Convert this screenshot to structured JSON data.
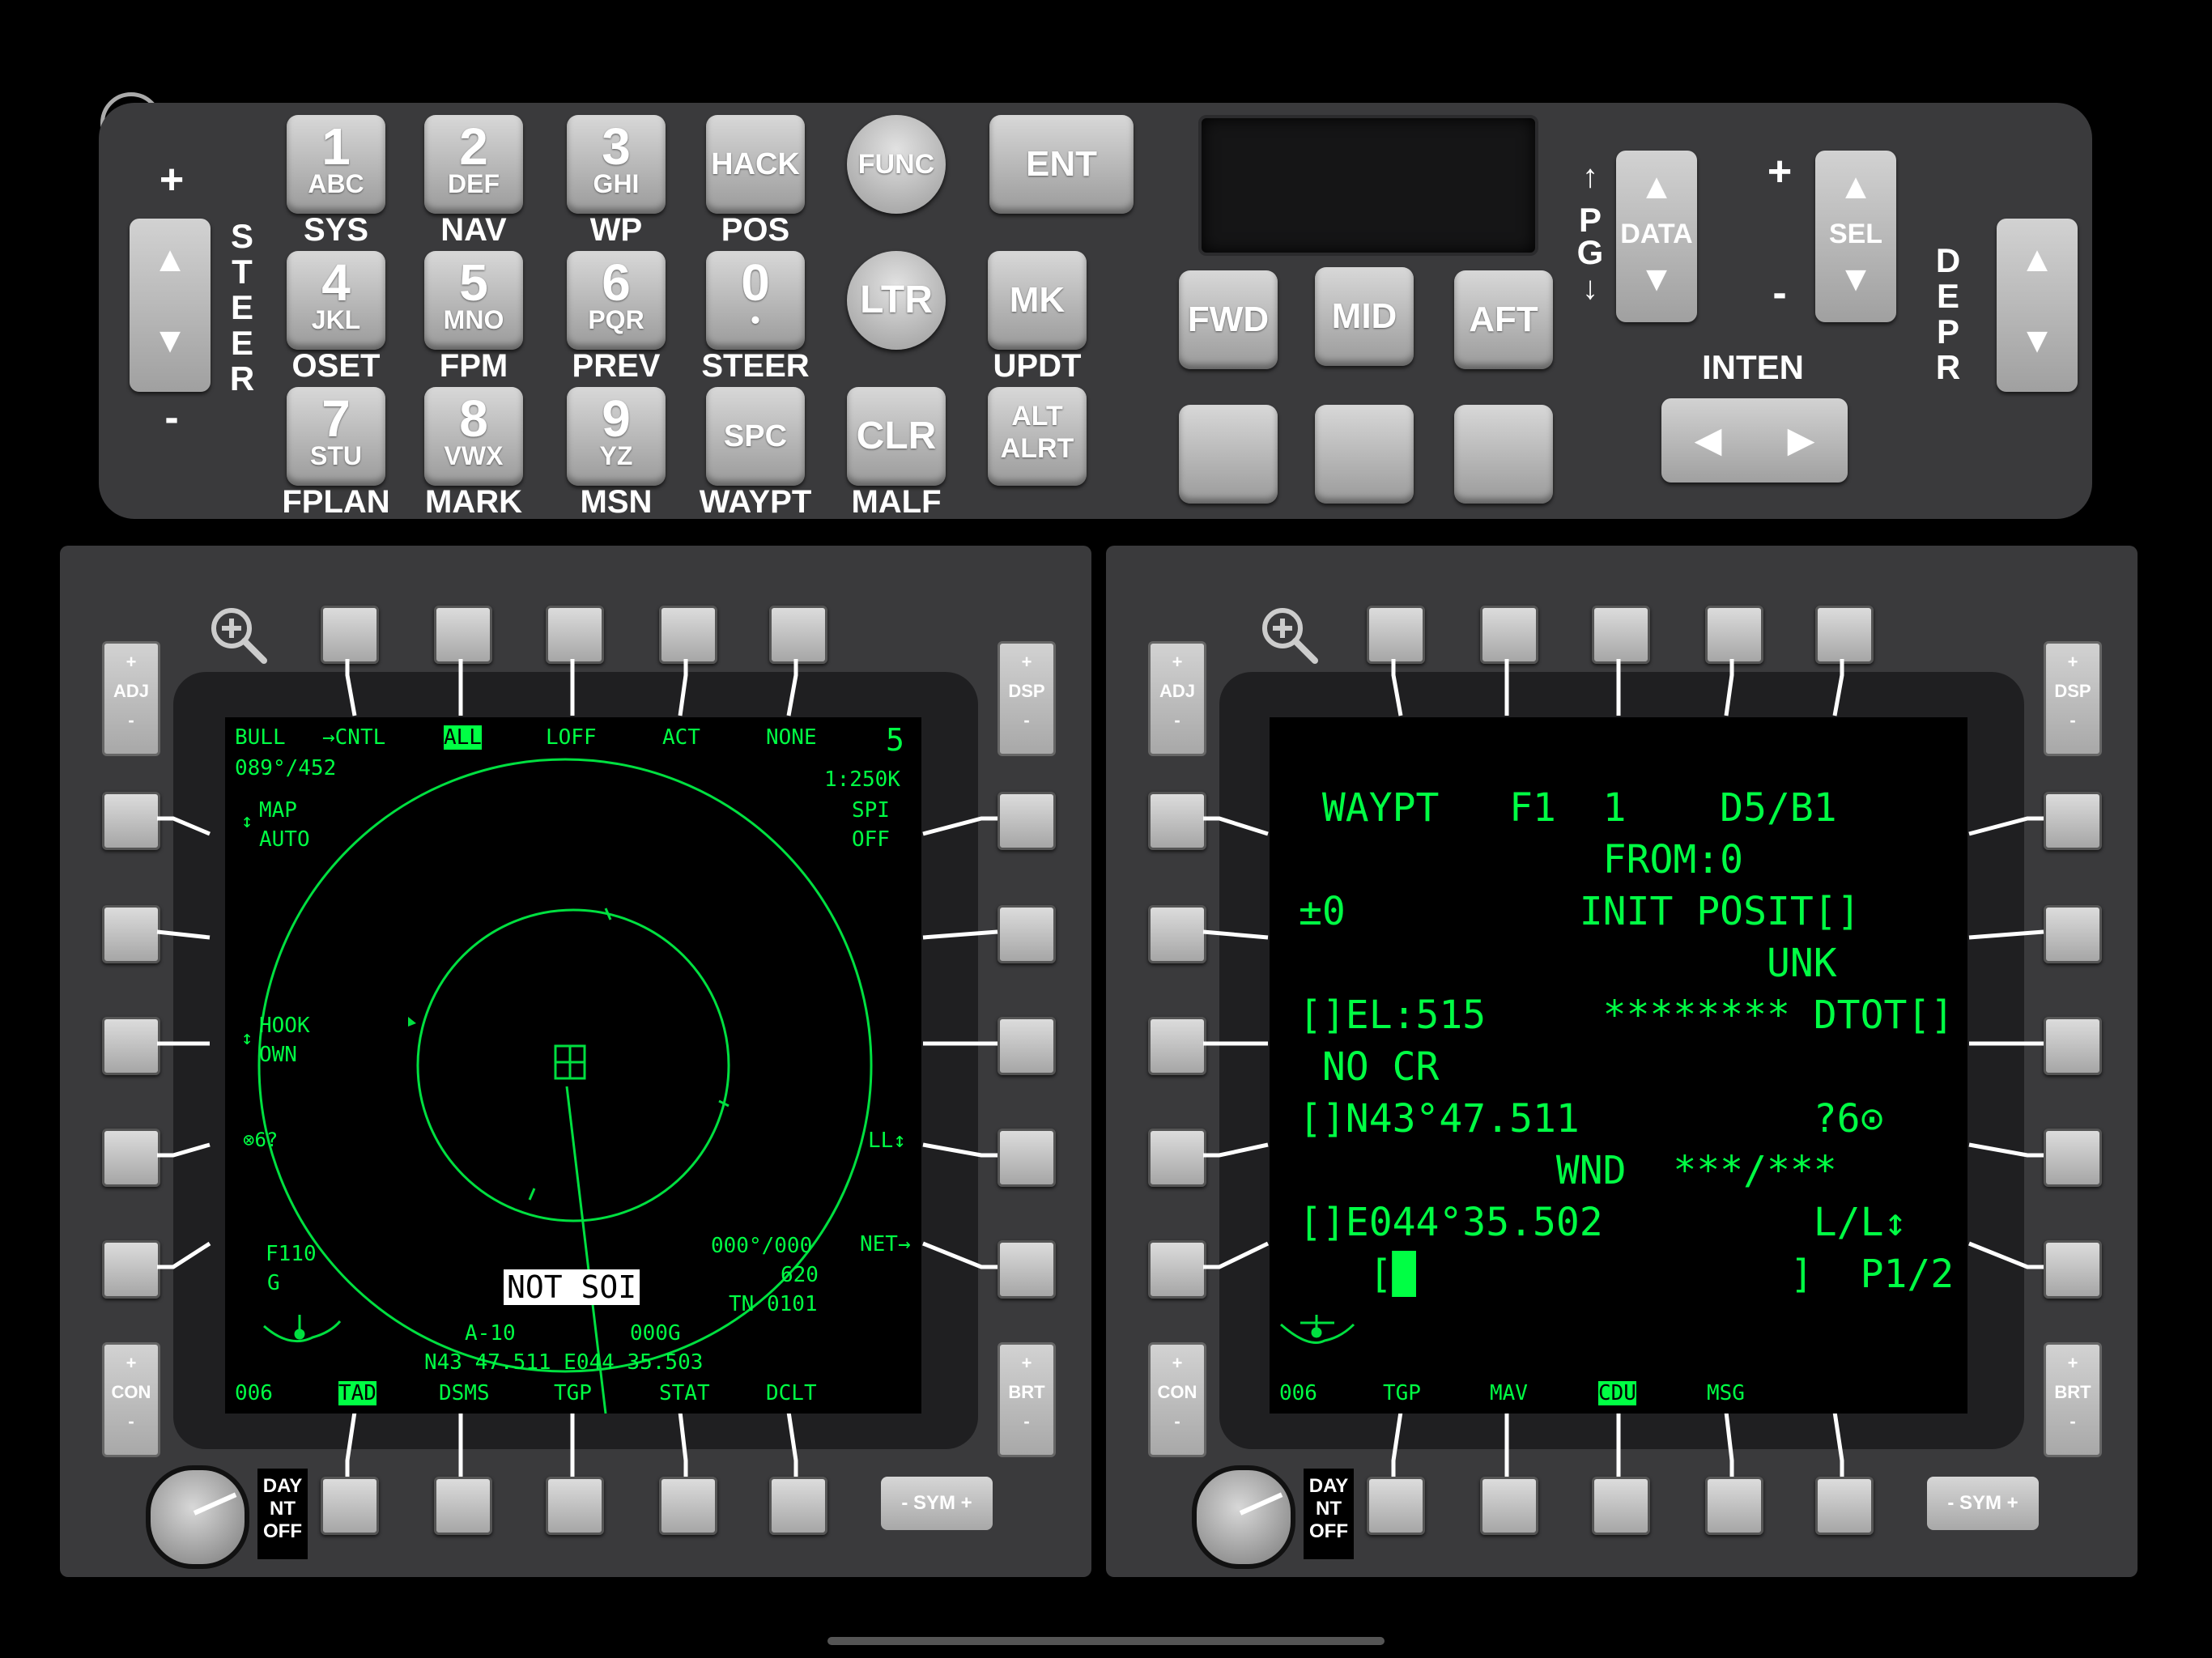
{
  "ufc": {
    "keys": [
      {
        "num": "1",
        "sub": "ABC",
        "label": "SYS"
      },
      {
        "num": "2",
        "sub": "DEF",
        "label": "NAV"
      },
      {
        "num": "3",
        "sub": "GHI",
        "label": "WP"
      },
      {
        "num": "4",
        "sub": "JKL",
        "label": "OSET"
      },
      {
        "num": "5",
        "sub": "MNO",
        "label": "FPM"
      },
      {
        "num": "6",
        "sub": "PQR",
        "label": "PREV"
      },
      {
        "num": "7",
        "sub": "STU",
        "label": "FPLAN"
      },
      {
        "num": "8",
        "sub": "VWX",
        "label": "MARK"
      },
      {
        "num": "9",
        "sub": "YZ",
        "label": "MSN"
      },
      {
        "num": "0",
        "sub": "•",
        "label": "STEER"
      }
    ],
    "hack": "HACK",
    "hack_label": "POS",
    "spc": "SPC",
    "spc_label": "WAYPT",
    "func": "FUNC",
    "ltr": "LTR",
    "clr": "CLR",
    "clr_label": "MALF",
    "ent": "ENT",
    "mk": "MK",
    "mk_label": "UPDT",
    "alt_alrt": [
      "ALT",
      "ALRT"
    ],
    "fwd": "FWD",
    "mid": "MID",
    "aft": "AFT",
    "steer_vertical": [
      "S",
      "T",
      "E",
      "E",
      "R"
    ],
    "pg_vertical": [
      "P",
      "G"
    ],
    "depr_vertical": [
      "D",
      "E",
      "P",
      "R"
    ],
    "plus": "+",
    "minus": "-",
    "data": "DATA",
    "sel": "SEL",
    "inten": "INTEN",
    "up": "▲",
    "down": "▼",
    "left": "◀",
    "right": "▶"
  },
  "left_mfd": {
    "side_adj": [
      "+",
      "ADJ",
      "-"
    ],
    "side_dsp": [
      "+",
      "DSP",
      "-"
    ],
    "side_con": [
      "+",
      "CON",
      "-"
    ],
    "side_brt": [
      "+",
      "BRT",
      "-"
    ],
    "day": [
      "DAY",
      "NT",
      "OFF"
    ],
    "sym": "-  SYM  +",
    "top": {
      "bull": "BULL",
      "cntl": "→CNTL",
      "all": "ALL",
      "loff": "LOFF",
      "act": "ACT",
      "none": "NONE",
      "page_num": "5"
    },
    "bull_val": "089°/452",
    "scale": "1:250K",
    "spi": "SPI",
    "spi_val": "OFF",
    "map": "MAP",
    "map_val": "AUTO",
    "hook": "HOOK",
    "hook_val": "OWN",
    "ll": "LL↕",
    "sixq": "⊗6?",
    "net": "NET→",
    "f110": "F110",
    "f110_g": "G",
    "bearing": "000°/000",
    "alt620": "620",
    "tn": "TN 0101",
    "not_soi": "NOT SOI",
    "a10": "A-10",
    "alt000": "000G",
    "pos": "N43 47.511 E044 35.503",
    "bottom": {
      "heading": "006",
      "tad": "TAD",
      "dsms": "DSMS",
      "tgp": "TGP",
      "stat": "STAT",
      "dclt": "DCLT"
    },
    "map_side_arrow": "↕",
    "hook_side_arrow": "↕"
  },
  "right_mfd": {
    "side_adj": [
      "+",
      "ADJ",
      "-"
    ],
    "side_dsp": [
      "+",
      "DSP",
      "-"
    ],
    "side_con": [
      "+",
      "CON",
      "-"
    ],
    "side_brt": [
      "+",
      "BRT",
      "-"
    ],
    "day": [
      "DAY",
      "NT",
      "OFF"
    ],
    "sym": "-  SYM  +",
    "lines": [
      " WAYPT   F1  1    D5/B1",
      "             FROM:0",
      "±0          INIT POSIT[]",
      "                    UNK",
      "[]EL:515     ******** DTOT[]",
      " NO CR",
      "[]N43°47.511          ?6⊙",
      "           WND  ***/***",
      "[]E044°35.502         L/L↕",
      "   [█                ]  P1/2"
    ],
    "bottom": {
      "heading": "006",
      "tgp": "TGP",
      "mav": "MAV",
      "cdu": "CDU",
      "msg": "MSG"
    }
  }
}
